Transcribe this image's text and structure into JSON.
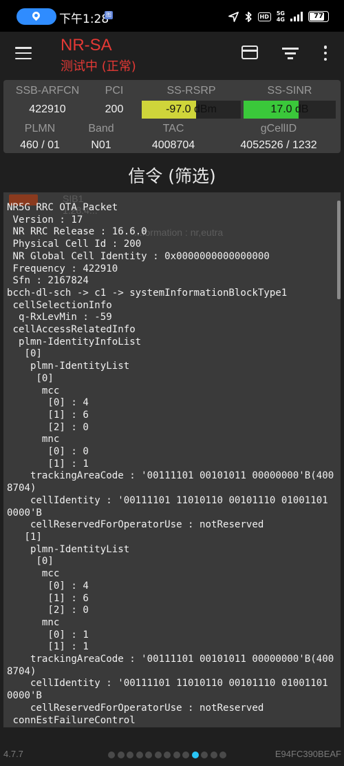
{
  "status_bar": {
    "time": "下午1:28",
    "notification_badge": "图",
    "hd_label": "HD",
    "network_label": "5G",
    "network_sub": "4G",
    "battery": "77",
    "icons": [
      "location-icon",
      "navigation-arrow-icon",
      "bluetooth-icon",
      "hd-icon",
      "signal-icon",
      "battery-icon"
    ]
  },
  "app_bar": {
    "title": "NR-SA",
    "subtitle": "测试中 (正常)",
    "title_color": "#e53935",
    "icons": [
      "menu-icon",
      "card-icon",
      "filter-icon",
      "more-vert-icon"
    ]
  },
  "info_panel": {
    "row1": {
      "labels": {
        "arfcn": "SSB-ARFCN",
        "pci": "PCI",
        "rsrp": "SS-RSRP",
        "sinr": "SS-SINR"
      },
      "values": {
        "arfcn": "422910",
        "pci": "200"
      }
    },
    "rsrp_meter": {
      "text": "-97.0 dBm",
      "fill_fraction": 0.55,
      "color": "#cfd53a"
    },
    "sinr_meter": {
      "text": "17.0 dB",
      "fill_fraction": 0.6,
      "color": "#3ac83a"
    },
    "row2": {
      "labels": {
        "plmn": "PLMN",
        "band": "Band",
        "tac": "TAC",
        "gcellid": "gCellID"
      },
      "values": {
        "plmn": "460 / 01",
        "band": "N01",
        "tac": "4008704",
        "gcellid": "4052526 / 1232"
      }
    }
  },
  "section_title": "信令 (筛选)",
  "ghost_lines": [
    "SIB1",
    "1:28:4...",
    "...formation : nr,eutra"
  ],
  "log_text": "NR5G RRC OTA Packet\n Version : 17\n NR RRC Release : 16.6.0\n Physical Cell Id : 200\n NR Global Cell Identity : 0x0000000000000000\n Frequency : 422910\n Sfn : 2167824\nbcch-dl-sch -> c1 -> systemInformationBlockType1\n cellSelectionInfo\n  q-RxLevMin : -59\n cellAccessRelatedInfo\n  plmn-IdentityInfoList\n   [0]\n    plmn-IdentityList\n     [0]\n      mcc\n       [0] : 4\n       [1] : 6\n       [2] : 0\n      mnc\n       [0] : 0\n       [1] : 1\n    trackingAreaCode : '00111101 00101011 00000000'B(4008704)\n    cellIdentity : '00111101 11010110 00101110 01001101 0000'B\n    cellReservedForOperatorUse : notReserved\n   [1]\n    plmn-IdentityList\n     [0]\n      mcc\n       [0] : 4\n       [1] : 6\n       [2] : 0\n      mnc\n       [0] : 1\n       [1] : 1\n    trackingAreaCode : '00111101 00101011 00000000'B(4008704)\n    cellIdentity : '00111101 11010110 00101110 01001101 0000'B\n    cellReservedForOperatorUse : notReserved\n connEstFailureControl\n   connEstFailCount : n1",
  "footer": {
    "version": "4.7.7",
    "device_id": "E94FC390BEAF",
    "page_dots": 13,
    "active_dot": 9
  }
}
